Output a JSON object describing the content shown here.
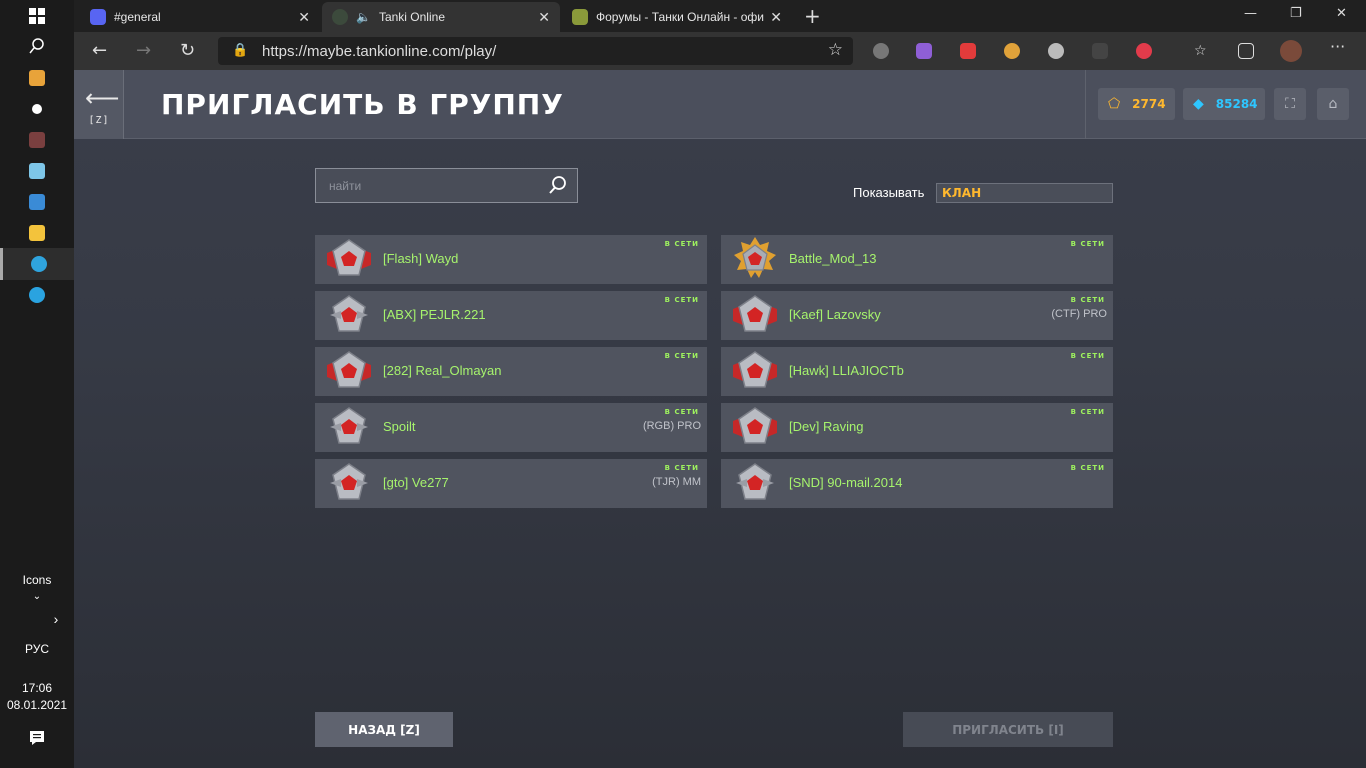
{
  "taskbar": {
    "icons_label": "Icons",
    "lang": "РУС",
    "time": "17:06",
    "date": "08.01.2021"
  },
  "browser": {
    "tabs": [
      {
        "title": "#general",
        "icon": "discord-icon",
        "active": false
      },
      {
        "title": "Tanki Online",
        "icon": "tanki-icon",
        "active": true
      },
      {
        "title": "Форумы - Танки Онлайн - офи",
        "icon": "tank-icon",
        "active": false
      }
    ],
    "url": "https://maybe.tankionline.com/play/"
  },
  "game": {
    "back_key": "[Z]",
    "title": "ПРИГЛАСИТЬ В ГРУППУ",
    "crystals_gold": "2774",
    "crystals_blue": "85284",
    "search_placeholder": "найти",
    "show_label": "Показывать",
    "show_value": "КЛАН",
    "players": [
      {
        "name": "[Flash] Wayd",
        "status": "В СЕТИ",
        "tag": "",
        "rank": "red"
      },
      {
        "name": "Battle_Mod_13",
        "status": "В СЕТИ",
        "tag": "",
        "rank": "gold"
      },
      {
        "name": "[ABX] PEJLR.221",
        "status": "В СЕТИ",
        "tag": "",
        "rank": "silver"
      },
      {
        "name": "[Kaef] Lazovsky",
        "status": "В СЕТИ",
        "tag": "(CTF) PRO",
        "rank": "red"
      },
      {
        "name": "[282] Real_Olmayan",
        "status": "В СЕТИ",
        "tag": "",
        "rank": "red"
      },
      {
        "name": "[Hawk] LLIAJIOCTb",
        "status": "В СЕТИ",
        "tag": "",
        "rank": "red"
      },
      {
        "name": "Spoilt",
        "status": "В СЕТИ",
        "tag": "(RGB) PRO",
        "rank": "silver"
      },
      {
        "name": "[Dev] Raving",
        "status": "В СЕТИ",
        "tag": "",
        "rank": "red"
      },
      {
        "name": "[gto] Ve277",
        "status": "В СЕТИ",
        "tag": "(TJR) MM",
        "rank": "silver"
      },
      {
        "name": "[SND] 90-mail.2014",
        "status": "В СЕТИ",
        "tag": "",
        "rank": "silver"
      }
    ],
    "back_button": "НАЗАД [Z]",
    "invite_button": "ПРИГЛАСИТЬ [I]"
  },
  "colors": {
    "name_green": "#a6f36d",
    "gold": "#ffb82e",
    "blue": "#2ec6ff"
  }
}
